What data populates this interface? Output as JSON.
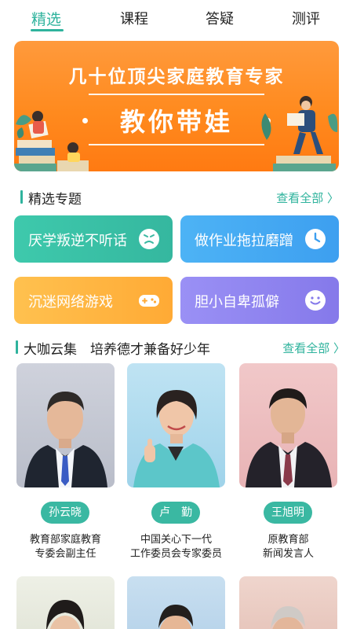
{
  "tabs": [
    {
      "label": "精选",
      "active": true
    },
    {
      "label": "课程",
      "active": false
    },
    {
      "label": "答疑",
      "active": false
    },
    {
      "label": "测评",
      "active": false
    }
  ],
  "banner": {
    "title": "几十位顶尖家庭教育专家",
    "subtitle": "教你带娃"
  },
  "topics_section": {
    "title": "精选专题",
    "more": "查看全部 〉"
  },
  "topics": [
    {
      "label": "厌学叛逆不听话",
      "icon": "angry-face-icon",
      "color": "#3ec2a6"
    },
    {
      "label": "做作业拖拉磨蹭",
      "icon": "clock-icon",
      "color": "#4aaaf2"
    },
    {
      "label": "沉迷网络游戏",
      "icon": "gamepad-icon",
      "color": "#ffb443"
    },
    {
      "label": "胆小自卑孤僻",
      "icon": "smile-face-icon",
      "color": "#8f85f0"
    }
  ],
  "experts_section": {
    "title": "大咖云集　培养德才兼备好少年",
    "more": "查看全部 〉"
  },
  "experts": [
    {
      "name": "孙云晓",
      "role_line1": "教育部家庭教育",
      "role_line2": "专委会副主任"
    },
    {
      "name": "卢　勤",
      "role_line1": "中国关心下一代",
      "role_line2": "工作委员会专家委员"
    },
    {
      "name": "王旭明",
      "role_line1": "原教育部",
      "role_line2": "新闻发言人"
    }
  ],
  "colors": {
    "accent": "#2fb39d",
    "banner": "#ff8a1e"
  }
}
